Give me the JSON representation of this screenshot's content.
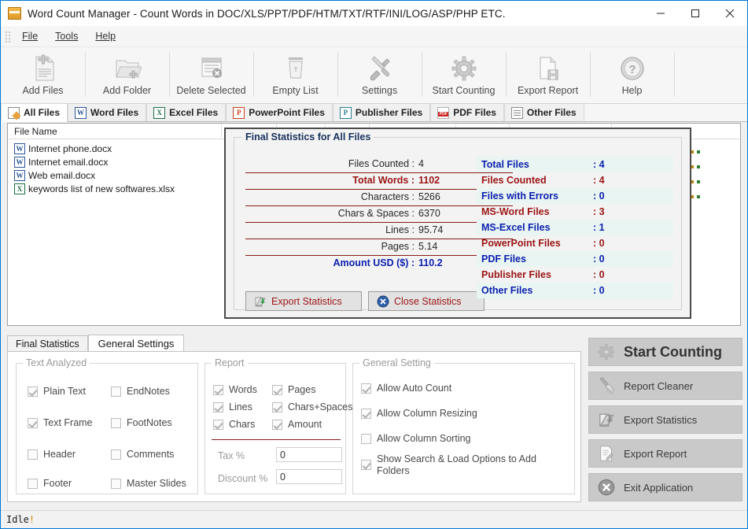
{
  "window": {
    "title": "Word Count Manager - Count Words in DOC/XLS/PPT/PDF/HTM/TXT/RTF/INI/LOG/ASP/PHP ETC.",
    "icon": "app-icon",
    "minimize": "—",
    "maximize": "□",
    "close": "✕"
  },
  "menubar": {
    "items": [
      {
        "label": "File"
      },
      {
        "label": "Tools"
      },
      {
        "label": "Help"
      }
    ]
  },
  "toolbar": {
    "items": [
      {
        "label": "Add Files",
        "icon": "add-files-icon"
      },
      {
        "label": "Add Folder",
        "icon": "add-folder-icon"
      },
      {
        "label": "Delete Selected",
        "icon": "delete-selected-icon"
      },
      {
        "label": "Empty List",
        "icon": "empty-list-icon"
      },
      {
        "label": "Settings",
        "icon": "settings-icon"
      },
      {
        "label": "Start Counting",
        "icon": "gear-icon"
      },
      {
        "label": "Export Report",
        "icon": "export-report-icon"
      },
      {
        "label": "Help",
        "icon": "help-icon"
      }
    ]
  },
  "file_tabs": [
    {
      "label": "All Files",
      "icon": "all-files-icon",
      "active": true
    },
    {
      "label": "Word Files",
      "icon": "word-icon",
      "active": false
    },
    {
      "label": "Excel Files",
      "icon": "excel-icon",
      "active": false
    },
    {
      "label": "PowerPoint Files",
      "icon": "powerpoint-icon",
      "active": false
    },
    {
      "label": "Publisher Files",
      "icon": "publisher-icon",
      "active": false
    },
    {
      "label": "PDF Files",
      "icon": "pdf-icon",
      "active": false
    },
    {
      "label": "Other Files",
      "icon": "other-files-icon",
      "active": false
    }
  ],
  "file_list": {
    "column_header": "File Name",
    "rows": [
      {
        "name": "Internet phone.docx",
        "icon": "word-icon"
      },
      {
        "name": "Internet email.docx",
        "icon": "word-icon"
      },
      {
        "name": "Web email.docx",
        "icon": "word-icon"
      },
      {
        "name": "keywords list of new softwares.xlsx",
        "icon": "excel-icon"
      }
    ]
  },
  "stats_dialog": {
    "title": "Final Statistics for All Files",
    "left_rows": [
      {
        "label": "Files Counted :",
        "value": "4",
        "style": "normal"
      },
      {
        "label": "Total Words :",
        "value": "1102",
        "style": "highlight"
      },
      {
        "label": "Characters :",
        "value": "5266",
        "style": "normal"
      },
      {
        "label": "Chars & Spaces :",
        "value": "6370",
        "style": "normal"
      },
      {
        "label": "Lines :",
        "value": "95.74",
        "style": "normal"
      },
      {
        "label": "Pages :",
        "value": "5.14",
        "style": "normal"
      },
      {
        "label": "Amount USD ($) :",
        "value": "110.2",
        "style": "amount"
      }
    ],
    "buttons": [
      {
        "label": "Export Statistics",
        "icon": "export-statistics-icon"
      },
      {
        "label": "Close Statistics",
        "icon": "close-circle-icon"
      }
    ],
    "right_rows": [
      {
        "label": "Total Files",
        "value": ": 4",
        "color": "navy"
      },
      {
        "label": "Files Counted",
        "value": ": 4",
        "color": "red"
      },
      {
        "label": "Files with Errors",
        "value": ": 0",
        "color": "navy"
      },
      {
        "label": "MS-Word Files",
        "value": ": 3",
        "color": "red"
      },
      {
        "label": "MS-Excel Files",
        "value": ": 1",
        "color": "navy"
      },
      {
        "label": "PowerPoint Files",
        "value": ": 0",
        "color": "red"
      },
      {
        "label": "PDF Files",
        "value": ": 0",
        "color": "navy"
      },
      {
        "label": "Publisher Files",
        "value": ": 0",
        "color": "red"
      },
      {
        "label": "Other Files",
        "value": ": 0",
        "color": "navy"
      }
    ]
  },
  "settings_tabs": [
    {
      "label": "Final Statistics",
      "active": false
    },
    {
      "label": "General Settings",
      "active": true
    }
  ],
  "text_analyzed": {
    "legend": "Text Analyzed",
    "items": [
      {
        "label": "Plain Text",
        "checked": true
      },
      {
        "label": "EndNotes",
        "checked": false
      },
      {
        "label": "Text Frame",
        "checked": true
      },
      {
        "label": "FootNotes",
        "checked": false
      },
      {
        "label": "Header",
        "checked": false
      },
      {
        "label": "Comments",
        "checked": false
      },
      {
        "label": "Footer",
        "checked": false
      },
      {
        "label": "Master Slides",
        "checked": false
      }
    ]
  },
  "report": {
    "legend": "Report",
    "items": [
      {
        "label": "Words",
        "checked": true
      },
      {
        "label": "Pages",
        "checked": true
      },
      {
        "label": "Lines",
        "checked": true
      },
      {
        "label": "Chars+Spaces",
        "checked": true
      },
      {
        "label": "Chars",
        "checked": true
      },
      {
        "label": "Amount",
        "checked": true
      }
    ],
    "tax_label": "Tax %",
    "tax_value": "0",
    "discount_label": "Discount %",
    "discount_value": "0"
  },
  "general_setting": {
    "legend": "General Setting",
    "items": [
      {
        "label": "Allow Auto Count",
        "checked": true
      },
      {
        "label": "Allow Column Resizing",
        "checked": true
      },
      {
        "label": "Allow Column Sorting",
        "checked": false
      },
      {
        "label": "Show Search & Load Options to Add Folders",
        "checked": true
      }
    ]
  },
  "action_buttons": [
    {
      "label": "Start Counting",
      "icon": "gear-icon",
      "primary": true
    },
    {
      "label": "Report Cleaner",
      "icon": "broom-icon",
      "primary": false
    },
    {
      "label": "Export Statistics",
      "icon": "export-statistics-icon",
      "primary": false
    },
    {
      "label": "Export Report",
      "icon": "export-report-icon",
      "primary": false
    },
    {
      "label": "Exit Application",
      "icon": "close-circle-icon",
      "primary": false
    }
  ],
  "statusbar": {
    "text": "Idle",
    "suffix": "!"
  },
  "colors": {
    "accent_blue": "#0078d7",
    "stat_red": "#9b1414",
    "stat_navy": "#0b1fb0",
    "separator_red": "#8b1a1a",
    "row_alt": "#e9f5f2"
  }
}
